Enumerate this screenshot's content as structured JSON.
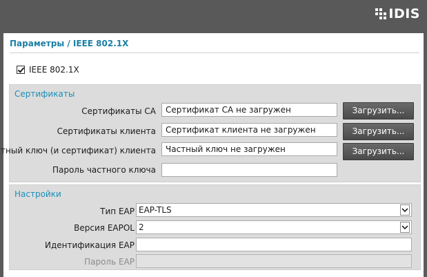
{
  "brand": {
    "logo_text": "IDIS"
  },
  "page": {
    "title": "Параметры / IEEE 802.1X"
  },
  "ieee_checkbox": {
    "label": "IEEE 802.1X",
    "checked": true
  },
  "certificates": {
    "title": "Сертификаты",
    "ca": {
      "label": "Сертификаты CA",
      "value": "Сертификат CA не загружен",
      "button": "Загрузить..."
    },
    "client": {
      "label": "Сертификаты клиента",
      "value": "Сертификат клиента не загружен",
      "button": "Загрузить..."
    },
    "private_key": {
      "label": "Частный ключ (и сертификат) клиента",
      "value": "Частный ключ не загружен",
      "button": "Загрузить..."
    },
    "key_password": {
      "label": "Пароль частного ключа",
      "value": ""
    }
  },
  "settings": {
    "title": "Настройки",
    "eap_type": {
      "label": "Тип EAP",
      "value": "EAP-TLS"
    },
    "eapol_version": {
      "label": "Версия EAPOL",
      "value": "2"
    },
    "eap_identity": {
      "label": "Идентификация EAP",
      "value": ""
    },
    "eap_password": {
      "label": "Пароль EAP",
      "value": "",
      "disabled": true
    }
  },
  "colors": {
    "header_bg": "#595959",
    "accent": "#1b7fa6",
    "group_bg": "#dcdcdc",
    "button_bg": "#555555"
  }
}
